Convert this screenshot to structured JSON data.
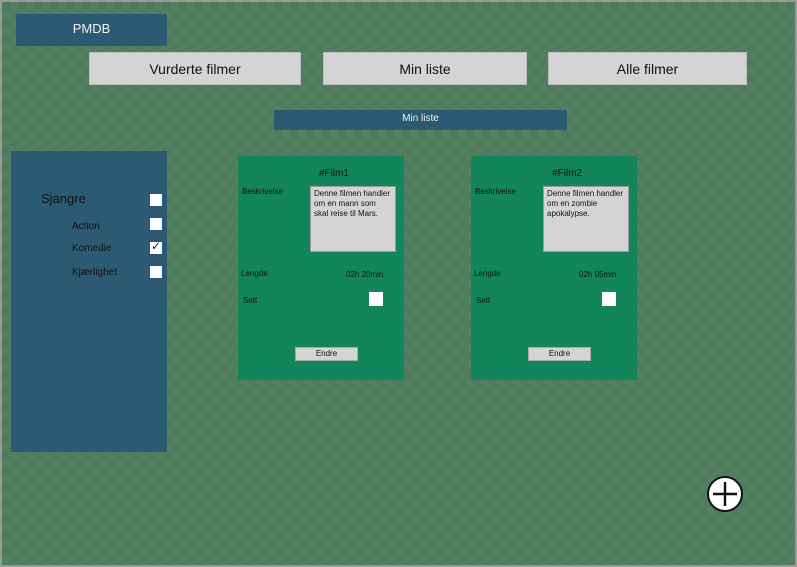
{
  "app": {
    "logo": "PMDB"
  },
  "nav": {
    "rated": "Vurderte filmer",
    "my_list": "Min liste",
    "all": "Alle filmer"
  },
  "section": {
    "title": "Min liste"
  },
  "sidebar": {
    "title": "Sjangre",
    "title_checked": false,
    "genres": [
      {
        "label": "Action",
        "checked": false
      },
      {
        "label": "Komedie",
        "checked": true
      },
      {
        "label": "Kjærlighet",
        "checked": false
      }
    ]
  },
  "films": [
    {
      "title": "#Film1",
      "description_label": "Beskrivelse",
      "description": "Denne filmen handler om en mann som skal reise til Mars.",
      "length_label": "Lengde",
      "length": "02h 20min",
      "seen_label": "Sett",
      "seen": false,
      "edit_label": "Endre"
    },
    {
      "title": "#Film2",
      "description_label": "Beskrivelse",
      "description": "Denne filmen handler om en zombie apokalypse.",
      "length_label": "Lengde",
      "length": "02h 05min",
      "seen_label": "Sett",
      "seen": false,
      "edit_label": "Endre"
    }
  ],
  "icons": {
    "add": "plus-circle-icon",
    "check": "checkmark-icon"
  },
  "colors": {
    "background": "#4e7b5c",
    "panel": "#2b5a72",
    "card": "#13855a",
    "button": "#d4d4d4"
  }
}
